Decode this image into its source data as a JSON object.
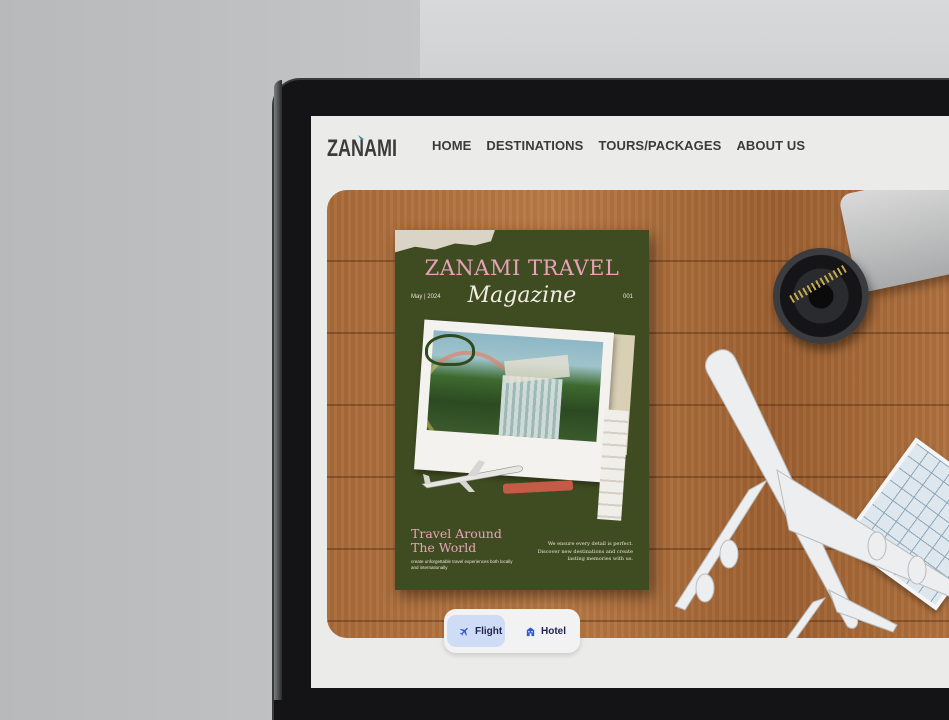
{
  "brand": {
    "logo_text": "ZANAMI",
    "accent": "#3b3b3b"
  },
  "nav": {
    "items": [
      {
        "label": "HOME"
      },
      {
        "label": "DESTINATIONS"
      },
      {
        "label": "TOURS/PACKAGES"
      },
      {
        "label": "ABOUT US"
      }
    ]
  },
  "hero": {
    "magazine": {
      "title": "ZANAMI TRAVEL",
      "subtitle": "Magazine",
      "date": "May | 2024",
      "issue": "001",
      "headline": "Travel Around\nThe World",
      "small_text": "create unforgettable travel experiences both locally and internationally",
      "right_text": "We ensure every detail is perfect. Discover new destinations and create lasting memories with us."
    }
  },
  "booking_tabs": {
    "items": [
      {
        "label": "Flight",
        "icon": "plane-icon",
        "active": true
      },
      {
        "label": "Hotel",
        "icon": "hotel-icon",
        "active": false
      }
    ],
    "active_color": "#cfdcf5"
  }
}
